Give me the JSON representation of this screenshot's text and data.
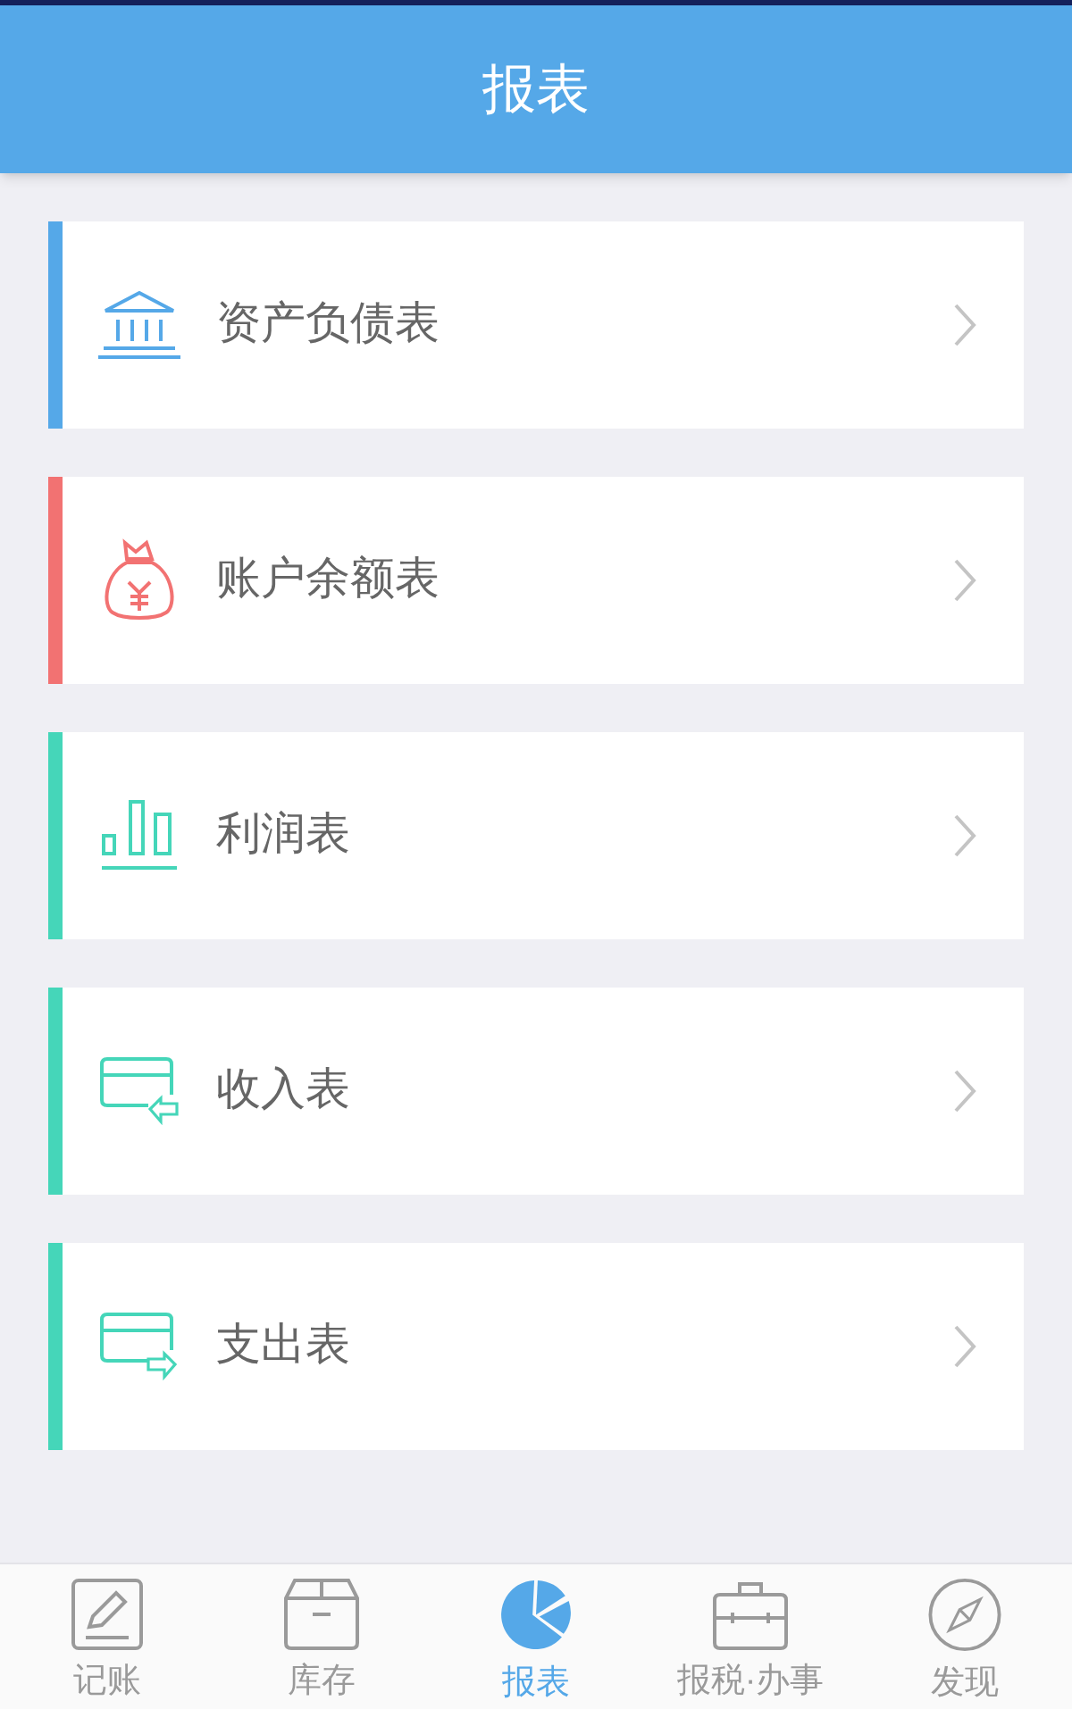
{
  "header": {
    "title": "报表"
  },
  "reports": [
    {
      "label": "资产负债表",
      "kind": "bank",
      "color": "#55a8e8"
    },
    {
      "label": "账户余额表",
      "kind": "moneybag",
      "color": "#f27272"
    },
    {
      "label": "利润表",
      "kind": "bars",
      "color": "#45d6b9"
    },
    {
      "label": "收入表",
      "kind": "card-in",
      "color": "#45d6b9"
    },
    {
      "label": "支出表",
      "kind": "card-out",
      "color": "#45d6b9"
    }
  ],
  "tab_bar": [
    {
      "label": "记账",
      "kind": "pencil",
      "selected": false
    },
    {
      "label": "库存",
      "kind": "box",
      "selected": false
    },
    {
      "label": "报表",
      "kind": "pie",
      "selected": true
    },
    {
      "label": "报税·办事",
      "kind": "briefcase",
      "selected": false
    },
    {
      "label": "发现",
      "kind": "compass",
      "selected": false
    }
  ]
}
